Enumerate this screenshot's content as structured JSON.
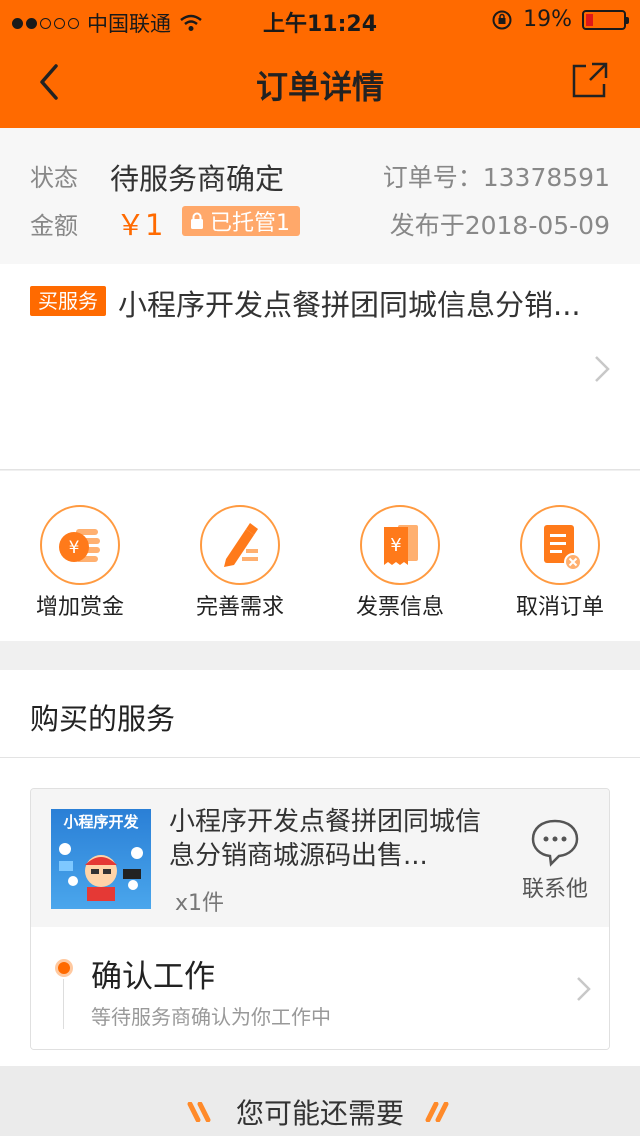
{
  "statusbar": {
    "carrier": "中国联通",
    "time": "上午11:24",
    "battery": "19%",
    "battery_level": 0.19
  },
  "nav": {
    "title": "订单详情"
  },
  "order": {
    "status_label": "状态",
    "status_value": "待服务商确定",
    "amount_label": "金额",
    "amount_value": "￥1",
    "escrow_text": "已托管1",
    "order_no_text": "订单号：13378591",
    "published_text": "发布于2018-05-09"
  },
  "service": {
    "tag": "买服务",
    "title": "小程序开发点餐拼团同城信息分销..."
  },
  "actions": [
    {
      "label": "增加赏金",
      "icon": "coin-stack-icon"
    },
    {
      "label": "完善需求",
      "icon": "edit-doc-icon"
    },
    {
      "label": "发票信息",
      "icon": "invoice-icon"
    },
    {
      "label": "取消订单",
      "icon": "cancel-order-icon"
    }
  ],
  "bought": {
    "heading": "购买的服务",
    "thumb_text": "小程序开发",
    "product_name": "小程序开发点餐拼团同城信息分销商城源码出售...",
    "qty": "x1件",
    "contact_label": "联系他",
    "step_title": "确认工作",
    "step_subtitle": "等待服务商确认为你工作中"
  },
  "suggest": {
    "title": "您可能还需要"
  },
  "colors": {
    "accent": "#ff6a00",
    "escrow": "#ffa86a"
  }
}
